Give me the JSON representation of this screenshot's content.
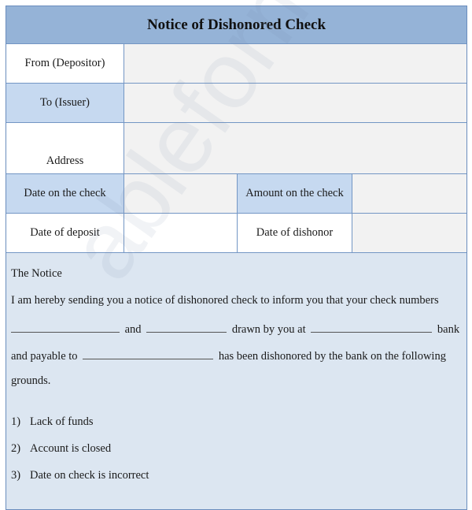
{
  "form": {
    "title": "Notice of Dishonored Check",
    "fields": {
      "from_label": "From (Depositor)",
      "from_value": "",
      "to_label": "To (Issuer)",
      "to_value": "",
      "address_label": "Address",
      "address_value": "",
      "date_on_check_label": "Date on the check",
      "date_on_check_value": "",
      "amount_label": "Amount on the check",
      "amount_value": "",
      "date_of_deposit_label": "Date of deposit",
      "date_of_deposit_value": "",
      "date_of_dishonor_label": "Date of dishonor",
      "date_of_dishonor_value": ""
    },
    "notice": {
      "heading": "The Notice",
      "line1": "I am hereby sending you a notice of dishonored check to inform you that your check numbers",
      "line2_and": "and",
      "line2_drawn": "drawn by you at",
      "line2_bank": "bank",
      "line3_payable": "and payable to",
      "line3_rest": "has been dishonored by the bank on the following",
      "line4": "grounds.",
      "grounds": [
        {
          "num": "1)",
          "text": "Lack of funds"
        },
        {
          "num": "2)",
          "text": "Account is closed"
        },
        {
          "num": "3)",
          "text": "Date on check is incorrect"
        }
      ]
    }
  },
  "watermark": "ableforms.com"
}
